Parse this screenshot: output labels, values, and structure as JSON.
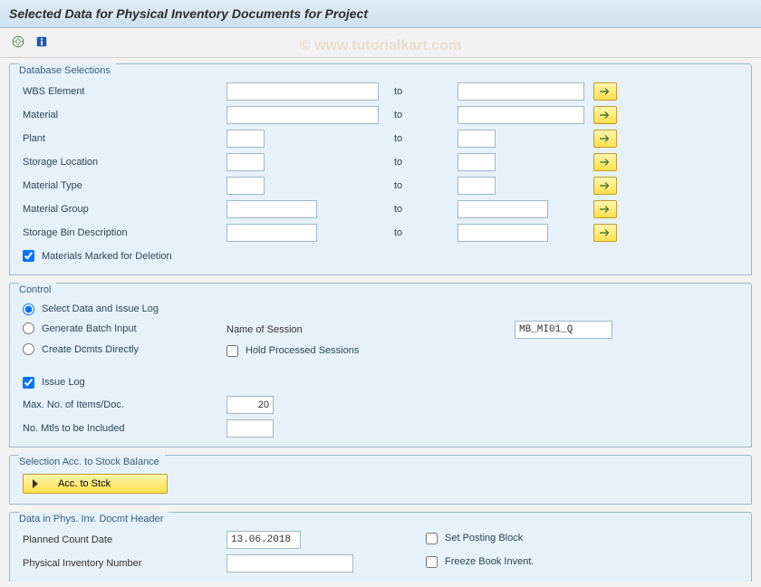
{
  "title": "Selected Data for Physical Inventory Documents for Project",
  "watermark": "© www.tutorialkart.com",
  "groups": {
    "db": {
      "title": "Database Selections",
      "wbs": "WBS Element",
      "material": "Material",
      "plant": "Plant",
      "storage_loc": "Storage Location",
      "mat_type": "Material Type",
      "mat_group": "Material Group",
      "storage_bin": "Storage Bin Description",
      "to": "to",
      "deletion": "Materials Marked for Deletion",
      "deletion_checked": true
    },
    "ctrl": {
      "title": "Control",
      "opt1": "Select Data and Issue Log",
      "opt2": "Generate Batch Input",
      "opt3": "Create Dcmts Directly",
      "selected": "opt1",
      "session_lbl": "Name of Session",
      "session_val": "MB_MI01_Q",
      "hold": "Hold Processed Sessions",
      "issue_log": "Issue Log",
      "issue_log_checked": true,
      "max_items": "Max. No. of Items/Doc.",
      "max_items_val": "20",
      "no_mtls": "No. Mtls to be Included",
      "no_mtls_val": ""
    },
    "stock": {
      "title": "Selection Acc. to Stock Balance",
      "button": "Acc. to Stck"
    },
    "header": {
      "title": "Data in Phys. Inv. Docmt Header",
      "planned_date": "Planned Count Date",
      "planned_date_val": "13.06.2018",
      "pin": "Physical Inventory Number",
      "pin_val": "",
      "set_posting": "Set Posting Block",
      "freeze": "Freeze Book Invent."
    }
  }
}
